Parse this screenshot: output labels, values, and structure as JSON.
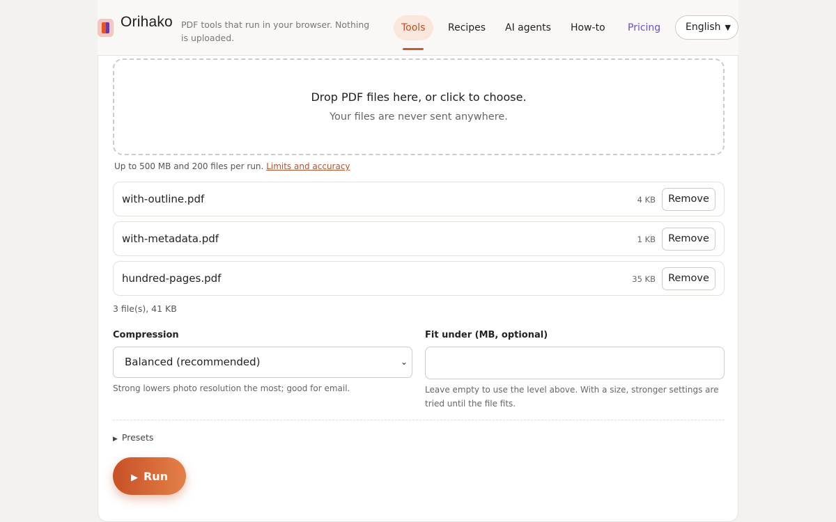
{
  "brand": {
    "name": "Orihako",
    "tagline": "PDF tools that run in your browser. Nothing is uploaded."
  },
  "nav": {
    "items": [
      {
        "label": "Tools",
        "active": true
      },
      {
        "label": "Recipes"
      },
      {
        "label": "AI agents"
      },
      {
        "label": "How-to"
      },
      {
        "label": "Pricing"
      }
    ],
    "language": "English"
  },
  "dropzone": {
    "title": "Drop PDF files here, or click to choose.",
    "subtitle": "Your files are never sent anywhere."
  },
  "limits": {
    "text": "Up to 500 MB and 200 files per run.",
    "link": "Limits and accuracy"
  },
  "files": [
    {
      "name": "with-outline.pdf",
      "size": "4 KB"
    },
    {
      "name": "with-metadata.pdf",
      "size": "1 KB"
    },
    {
      "name": "hundred-pages.pdf",
      "size": "35 KB"
    }
  ],
  "remove_label": "Remove",
  "file_summary": "3 file(s), 41 KB",
  "compression": {
    "label": "Compression",
    "value": "Balanced (recommended)",
    "help": "Strong lowers photo resolution the most; good for email."
  },
  "fit_under": {
    "label": "Fit under (MB, optional)",
    "value": "",
    "help": "Leave empty to use the level above. With a size, stronger settings are tried until the file fits."
  },
  "presets_label": "Presets",
  "run_label": "Run",
  "colors": {
    "accent": "#c95a2b",
    "pricing": "#6a4fc0",
    "run_start": "#c85026",
    "run_end": "#e38147"
  }
}
